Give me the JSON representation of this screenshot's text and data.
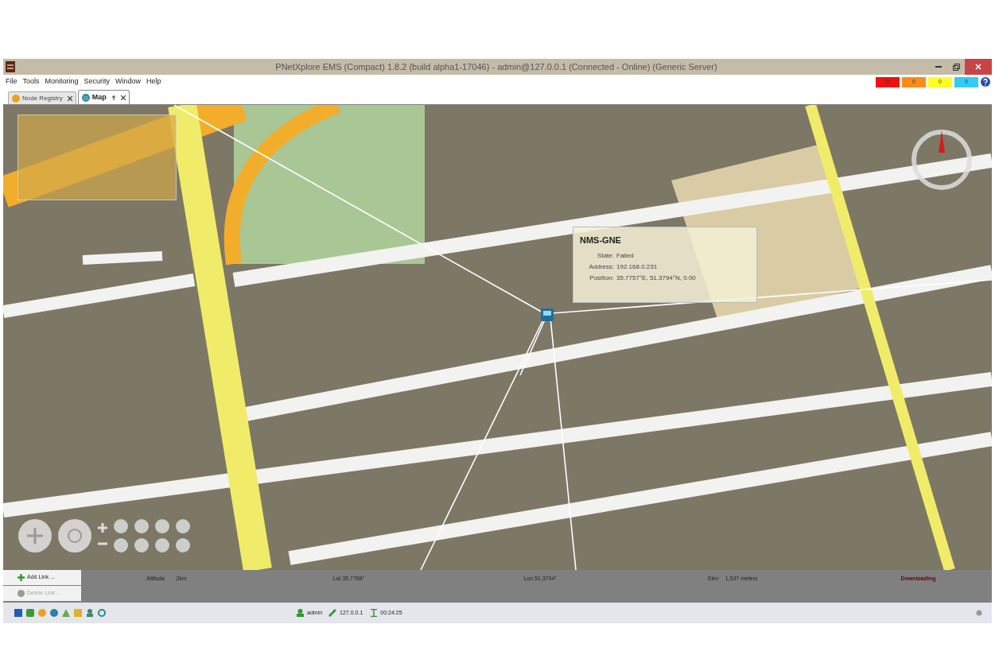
{
  "window": {
    "title": "PNetXplore EMS (Compact) 1.8.2 (build alpha1-17046) - admin@127.0.0.1 (Connected - Online) (Generic Server)"
  },
  "menu": [
    "File",
    "Tools",
    "Monitoring",
    "Security",
    "Window",
    "Help"
  ],
  "alarm_counters": [
    {
      "count": "0",
      "color": "#ee1111"
    },
    {
      "count": "0",
      "color": "#ff8c1a"
    },
    {
      "count": "0",
      "color": "#ffff22"
    },
    {
      "count": "0",
      "color": "#33ccf5"
    }
  ],
  "tabs": [
    {
      "label": "Node Registry",
      "kind": "registry",
      "selected": false
    },
    {
      "label": "Map",
      "kind": "map",
      "selected": true
    }
  ],
  "node_tooltip": {
    "title": "NMS-GNE",
    "rows": [
      {
        "label": "State:",
        "value": "Failed"
      },
      {
        "label": "Address:",
        "value": "192.168.0.231"
      },
      {
        "label": "Position:",
        "value": "35.7757°E, 51.3794°N, 0.00"
      }
    ]
  },
  "link_buttons": [
    {
      "label": "Add Link ...",
      "kind": "add",
      "disabled": false
    },
    {
      "label": "Delete Link ...",
      "kind": "delete",
      "disabled": true
    }
  ],
  "map_status": {
    "altitude_label": "Altitude",
    "altitude": "2km",
    "lat": "Lat 35.7758°",
    "lon": "Lon 51.3794°",
    "elev_label": "Elev",
    "elev": "1,537 meters",
    "activity": "Downloading"
  },
  "status_bar": {
    "user": "admin",
    "server": "127.0.0.1",
    "uptime": "00:24:25"
  }
}
